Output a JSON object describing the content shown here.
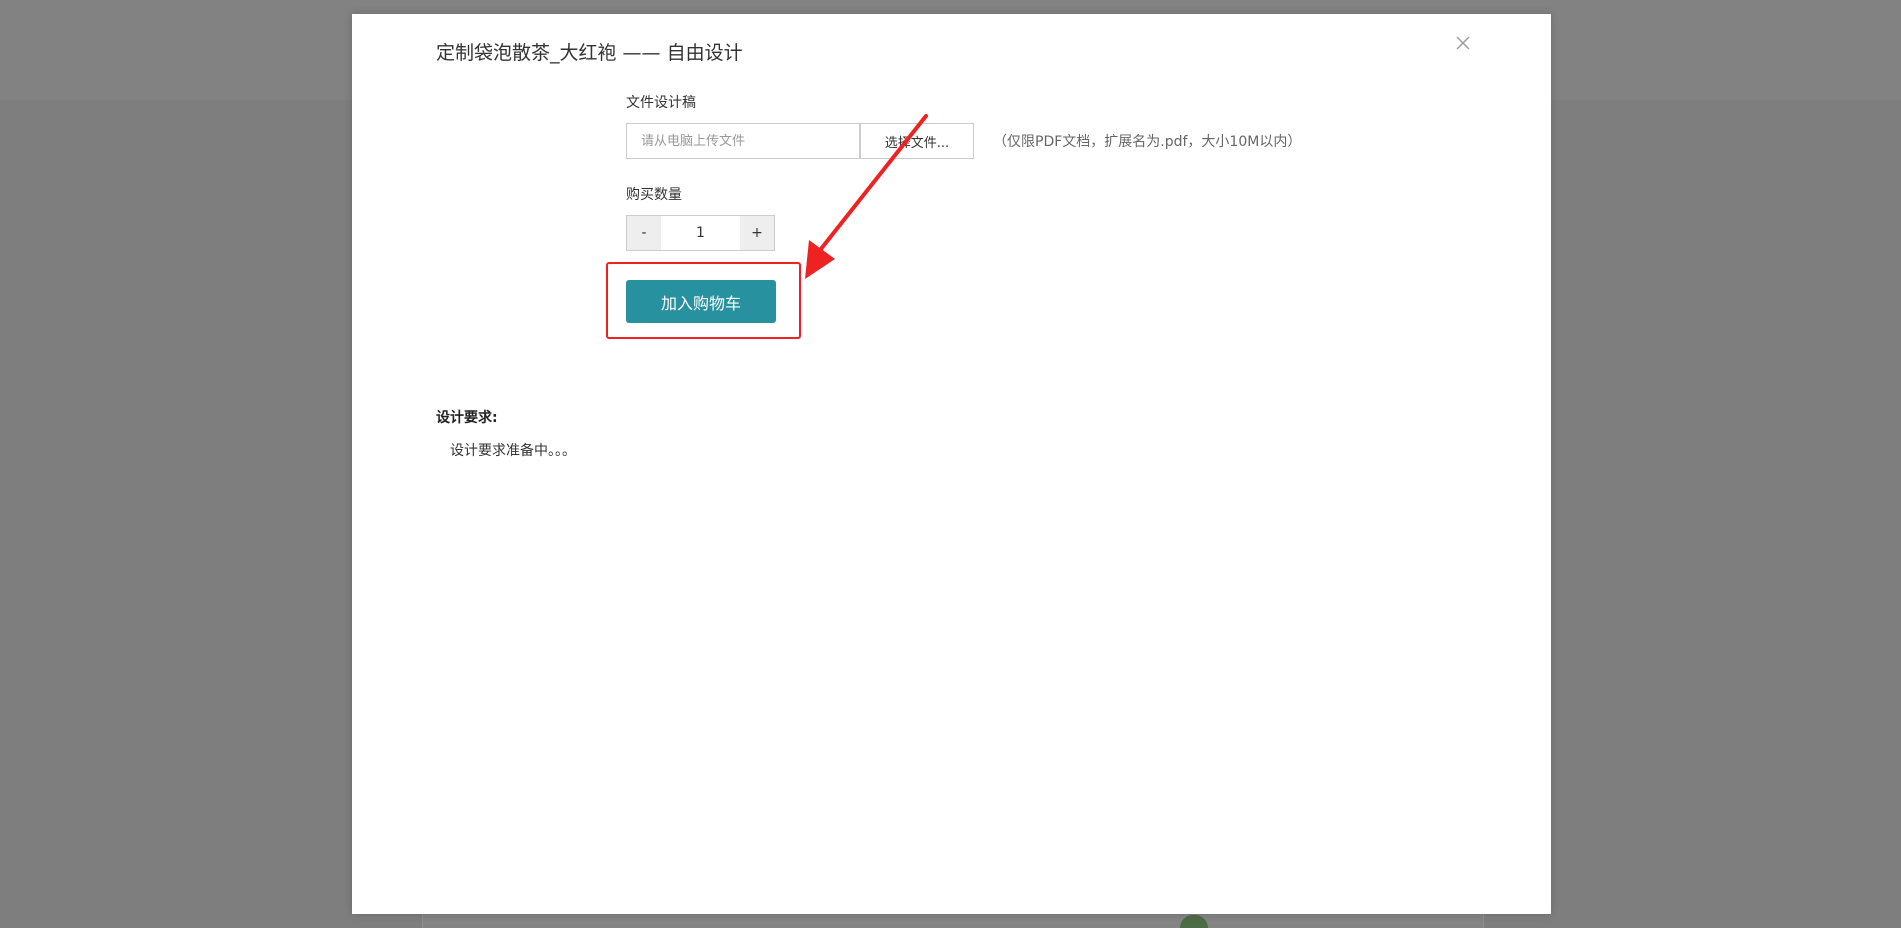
{
  "dialog": {
    "title": "定制袋泡散茶_大红袍 —— 自由设计"
  },
  "upload": {
    "label": "文件设计稿",
    "placeholder": "请从电脑上传文件",
    "button_label": "选择文件...",
    "hint": "（仅限PDF文档，扩展名为.pdf，大小10M以内）"
  },
  "quantity": {
    "label": "购买数量",
    "minus": "-",
    "value": "1",
    "plus": "+"
  },
  "cart": {
    "button_label": "加入购物车"
  },
  "design_requirements": {
    "title": "设计要求:",
    "text": "设计要求准备中。。。"
  },
  "icons": {
    "close": "close-icon"
  },
  "colors": {
    "primary_button": "#2891a0",
    "annotation_red": "#ee2222",
    "overlay": "#7e7e7e"
  }
}
